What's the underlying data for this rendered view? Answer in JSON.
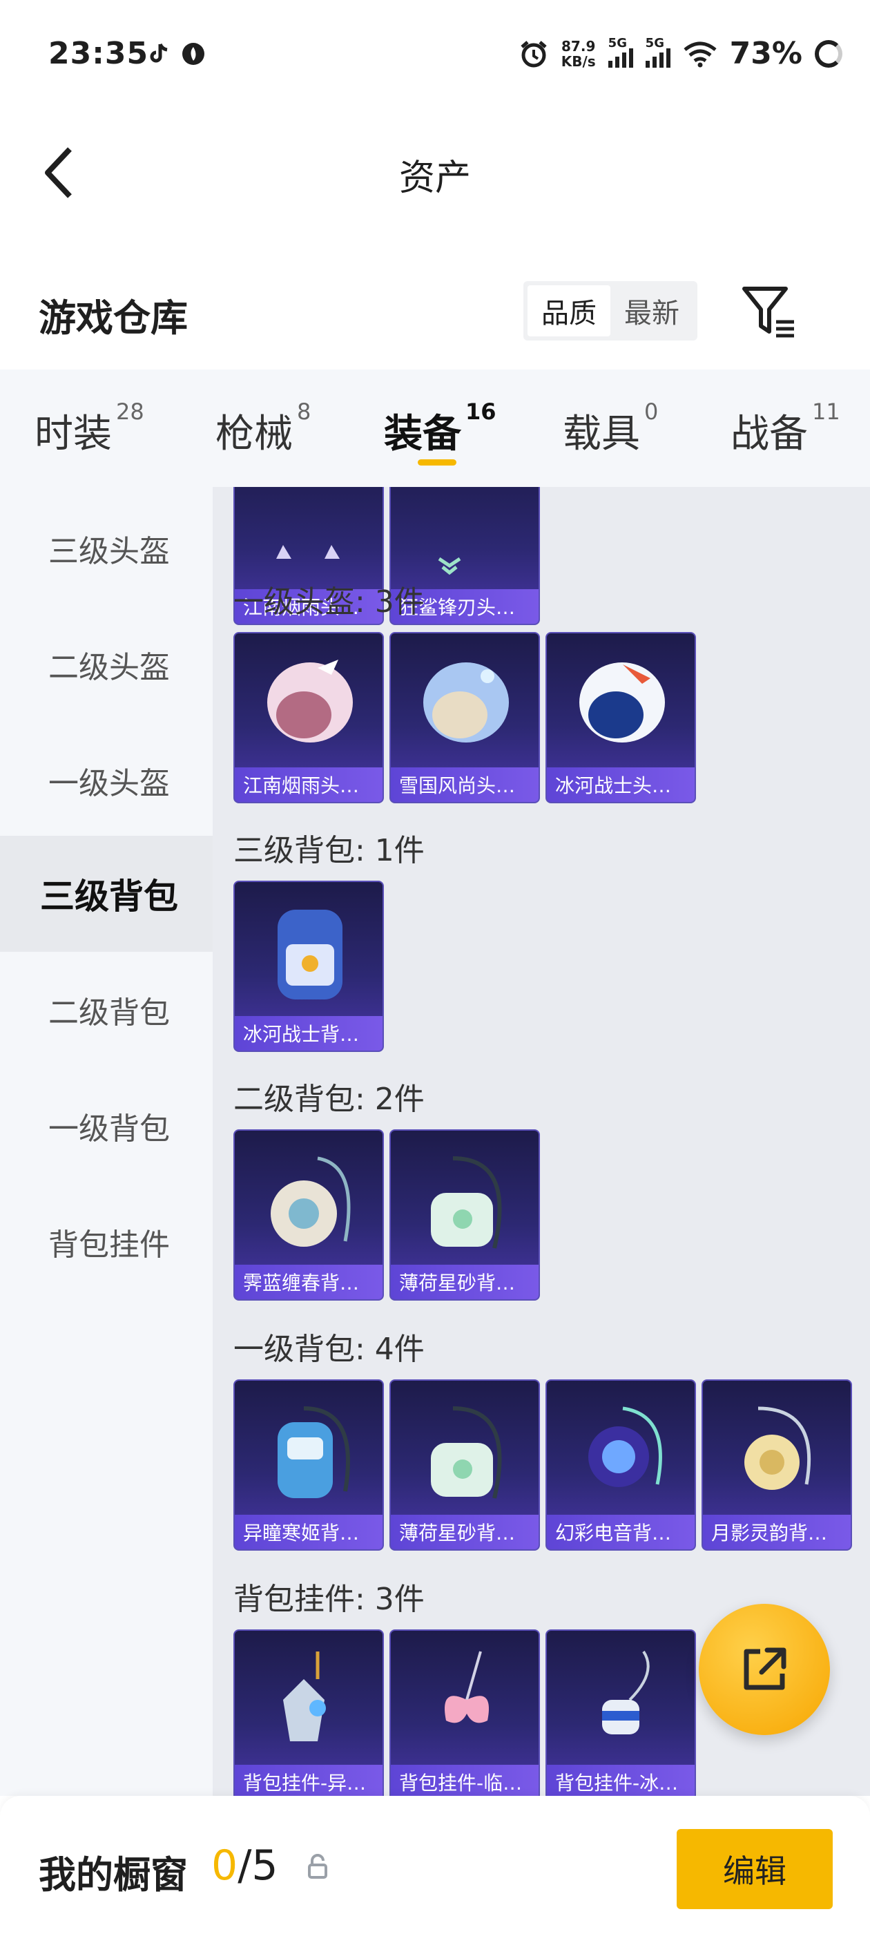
{
  "status_bar": {
    "time": "23:35",
    "net_speed_value": "87.9",
    "net_speed_unit": "KB/s",
    "signal1": "5G",
    "signal2": "5G",
    "battery": "73%"
  },
  "header": {
    "title": "资产"
  },
  "warehouse": {
    "title": "游戏仓库",
    "sort_options": [
      "品质",
      "最新"
    ],
    "active_sort": "品质"
  },
  "tabs": [
    {
      "label": "时装",
      "count": "28"
    },
    {
      "label": "枪械",
      "count": "8"
    },
    {
      "label": "装备",
      "count": "16",
      "active": true
    },
    {
      "label": "载具",
      "count": "0"
    },
    {
      "label": "战备",
      "count": "11"
    }
  ],
  "sidebar": {
    "items": [
      {
        "label": "三级头盔"
      },
      {
        "label": "二级头盔"
      },
      {
        "label": "一级头盔"
      },
      {
        "label": "三级背包",
        "active": true
      },
      {
        "label": "二级背包"
      },
      {
        "label": "一级背包"
      },
      {
        "label": "背包挂件"
      }
    ]
  },
  "sections": [
    {
      "title": "",
      "items": [
        "江南烟雨头…",
        "狂鲨锋刃头…"
      ]
    },
    {
      "title": "一级头盔: 3件",
      "items": [
        "江南烟雨头…",
        "雪国风尚头…",
        "冰河战士头…"
      ]
    },
    {
      "title": "三级背包: 1件",
      "items": [
        "冰河战士背…"
      ]
    },
    {
      "title": "二级背包: 2件",
      "items": [
        "霁蓝缠春背…",
        "薄荷星砂背…"
      ]
    },
    {
      "title": "一级背包: 4件",
      "items": [
        "异瞳寒姬背…",
        "薄荷星砂背…",
        "幻彩电音背…",
        "月影灵韵背…"
      ]
    },
    {
      "title": "背包挂件: 3件",
      "items": [
        "背包挂件-异…",
        "背包挂件-临…",
        "背包挂件-冰…"
      ]
    }
  ],
  "bottom_bar": {
    "title": "我的橱窗",
    "current": "0",
    "total": "/5",
    "edit_label": "编辑"
  },
  "colors": {
    "accent": "#f6b800",
    "card_label": "#6a4fe0"
  }
}
